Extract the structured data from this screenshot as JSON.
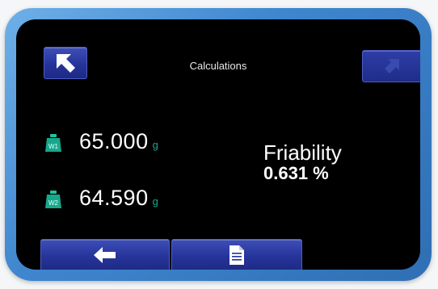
{
  "header": {
    "title": "Calculations",
    "back_icon": "arrow-up-left-icon",
    "forward_icon": "arrow-up-right-icon"
  },
  "weights": [
    {
      "icon_label": "W1",
      "value": "65.000",
      "unit": "g"
    },
    {
      "icon_label": "W2",
      "value": "64.590",
      "unit": "g"
    }
  ],
  "result": {
    "label": "Friability",
    "value": "0.631 %"
  },
  "bottom_bar": {
    "left_icon": "arrow-left-icon",
    "right_icon": "document-icon"
  },
  "colors": {
    "accent_blue": "#26349a",
    "frame_blue": "#3f86cf",
    "weight_green": "#17a88c",
    "background": "#000000",
    "text": "#ffffff"
  }
}
